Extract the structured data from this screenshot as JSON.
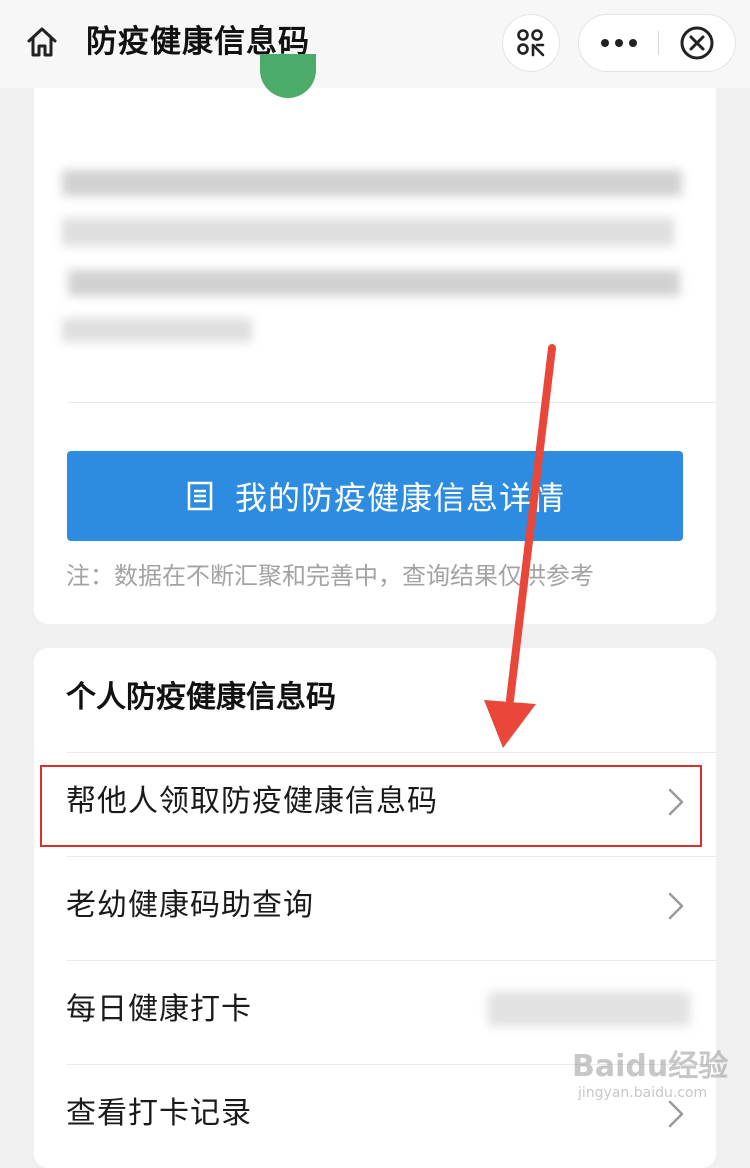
{
  "header": {
    "title": "防疫健康信息码",
    "icons": {
      "home": "home-icon",
      "scan": "scan-icon",
      "more": "more-icon",
      "close": "close-icon"
    }
  },
  "card": {
    "detail_button_label": "我的防疫健康信息详情",
    "detail_button_icon": "document-icon",
    "note": "注：数据在不断汇聚和完善中，查询结果仅供参考",
    "accent_color": "#2d8ce0",
    "status_color": "#4caa6a"
  },
  "menu": {
    "section_title": "个人防疫健康信息码",
    "items": [
      {
        "label": "帮他人领取防疫健康信息码"
      },
      {
        "label": "老幼健康码助查询"
      },
      {
        "label": "每日健康打卡"
      },
      {
        "label": "查看打卡记录"
      }
    ]
  },
  "annotation": {
    "highlight_color": "#d9322c",
    "arrow_color": "#e8473a"
  },
  "watermark": {
    "brand": "Baidu经验",
    "url": "jingyan.baidu.com"
  }
}
